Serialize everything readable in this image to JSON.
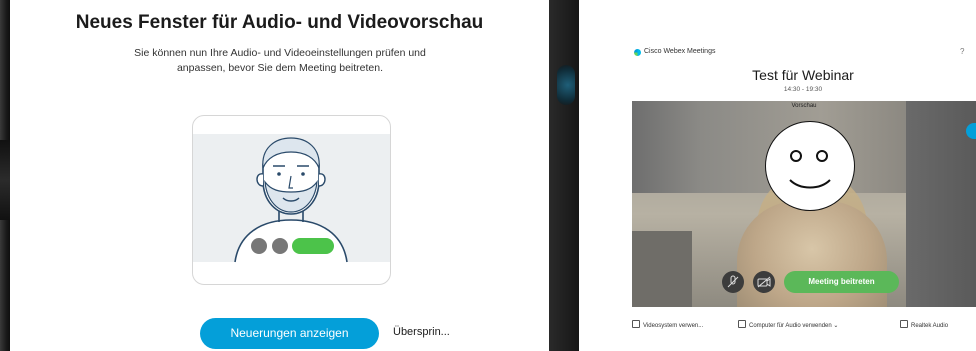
{
  "dialog": {
    "title": "Neues Fenster für Audio- und Videovorschau",
    "description": "Sie können nun Ihre Audio- und Videoeinstellungen prüfen und anpassen, bevor Sie dem Meeting beitreten.",
    "primary_button": "Neuerungen anzeigen",
    "skip_button": "Übersprin..."
  },
  "webex": {
    "app_name": "Cisco Webex Meetings",
    "help_icon": "?",
    "meeting_title": "Test für Webinar",
    "time": "14:30 - 19:30",
    "preview_label": "Vorschau",
    "mute_icon": "microphone-mute-icon",
    "video_icon": "video-off-icon",
    "join_button": "Meeting beitreten",
    "bottom": {
      "video_system": "Videosystem verwen...",
      "audio": "Computer für Audio verwenden",
      "speaker": "Realtek Audio"
    }
  },
  "colors": {
    "primary_blue": "#049fd9",
    "join_green": "#5bb859",
    "illus_green": "#4cc34a",
    "illus_gray": "#777777"
  }
}
